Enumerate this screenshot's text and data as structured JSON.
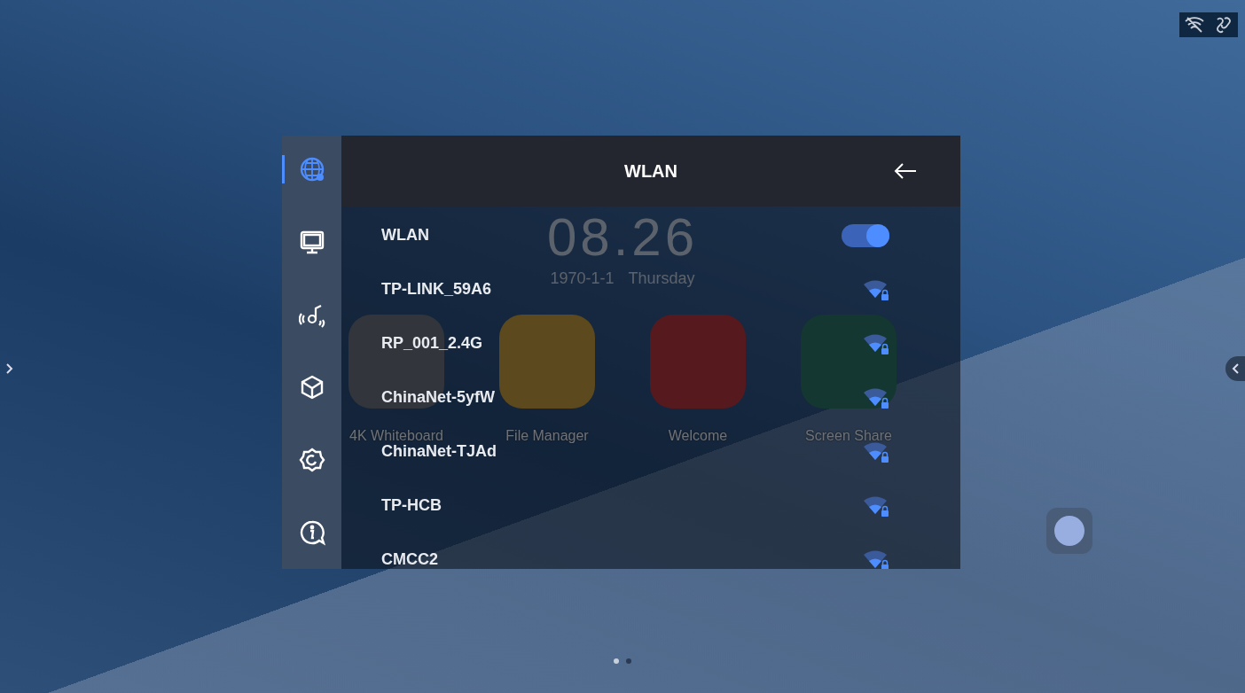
{
  "home": {
    "clock": "08.26",
    "date": "1970-1-1",
    "weekday": "Thursday",
    "apps": [
      {
        "label": "4K Whiteboard",
        "kind": "whiteboard"
      },
      {
        "label": "File Manager",
        "kind": "files"
      },
      {
        "label": "Welcome",
        "kind": "welcome"
      },
      {
        "label": "Screen Share",
        "kind": "share"
      }
    ],
    "page_dots": [
      {
        "selected": true
      },
      {
        "selected": false
      }
    ]
  },
  "sidebar": {
    "items": [
      {
        "kind": "network",
        "selected": true
      },
      {
        "kind": "display",
        "selected": false
      },
      {
        "kind": "sound",
        "selected": false
      },
      {
        "kind": "apps",
        "selected": false
      },
      {
        "kind": "settings",
        "selected": false
      },
      {
        "kind": "about",
        "selected": false
      }
    ]
  },
  "panel": {
    "title": "WLAN",
    "toggle": {
      "label": "WLAN",
      "on": true
    },
    "networks": [
      {
        "name": "TP-LINK_59A6",
        "locked": true
      },
      {
        "name": "RP_001_2.4G",
        "locked": true
      },
      {
        "name": "ChinaNet-5yfW",
        "locked": true
      },
      {
        "name": "ChinaNet-TJAd",
        "locked": true
      },
      {
        "name": "TP-HCB",
        "locked": true
      },
      {
        "name": "CMCC2",
        "locked": true
      }
    ]
  }
}
